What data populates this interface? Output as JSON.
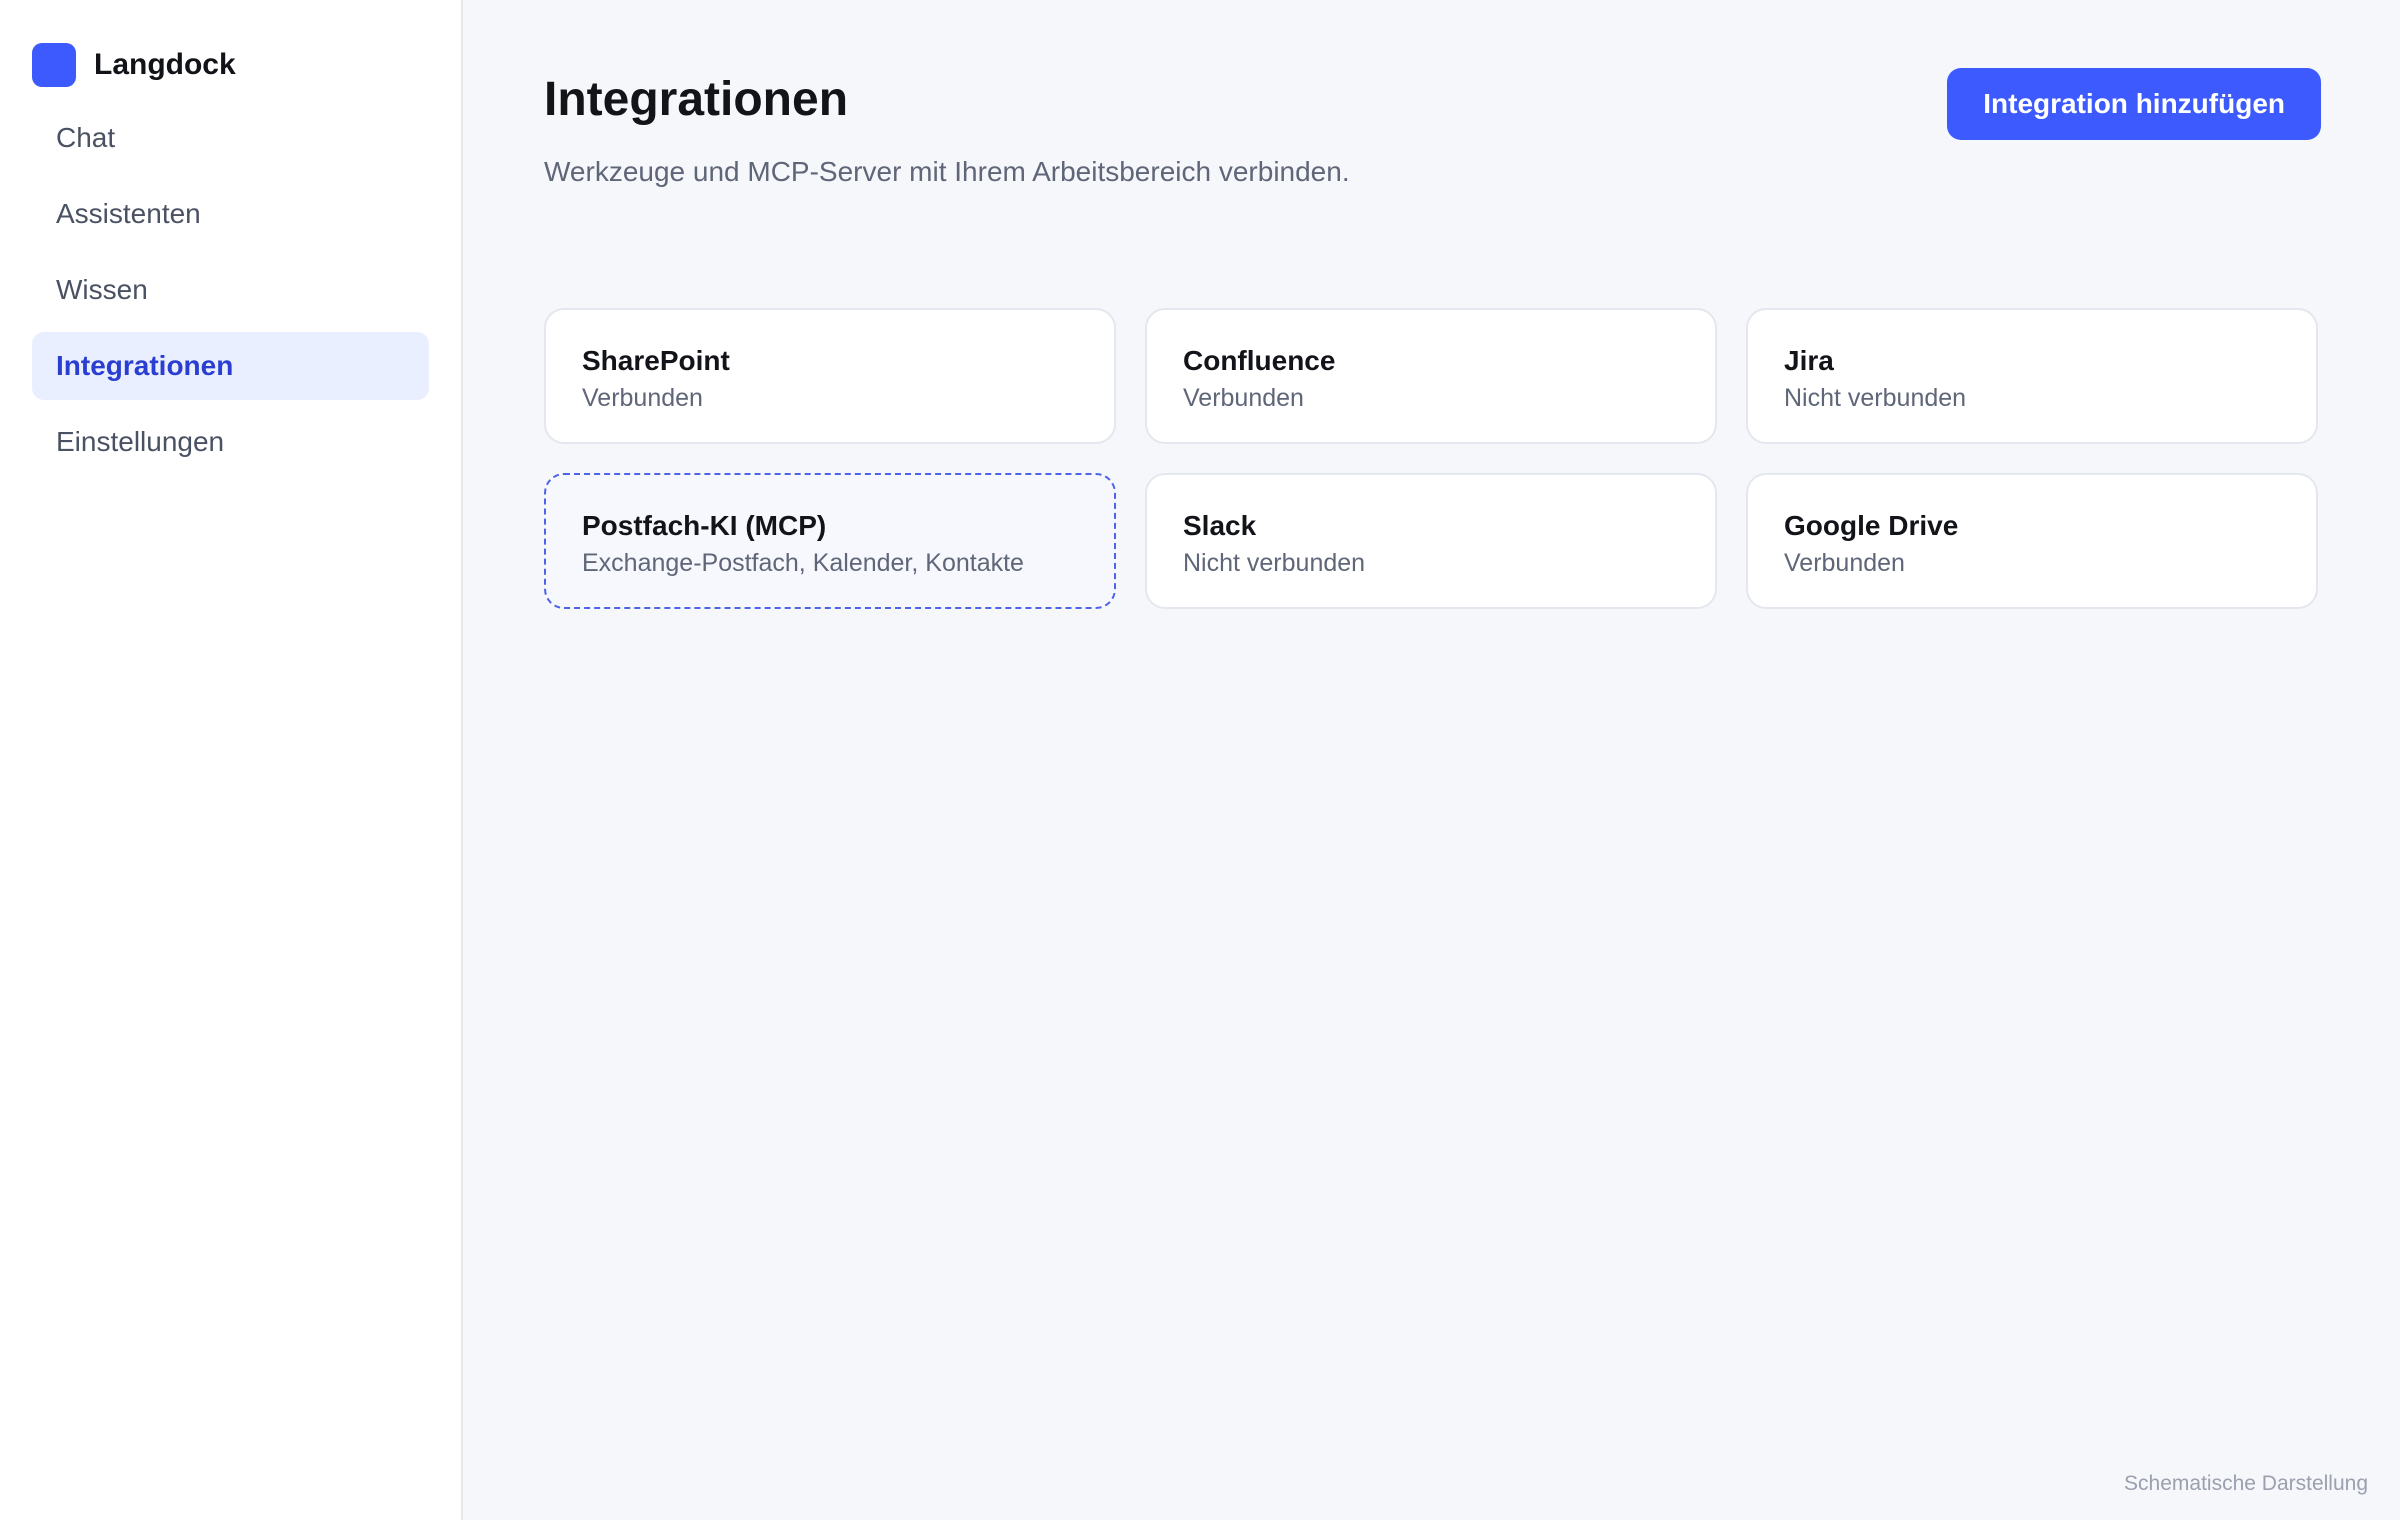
{
  "brand": {
    "name": "Langdock",
    "logo_color": "#3d5afe"
  },
  "sidebar": {
    "items": [
      {
        "label": "Chat",
        "active": false
      },
      {
        "label": "Assistenten",
        "active": false
      },
      {
        "label": "Wissen",
        "active": false
      },
      {
        "label": "Integrationen",
        "active": true
      },
      {
        "label": "Einstellungen",
        "active": false
      }
    ]
  },
  "header": {
    "title": "Integrationen",
    "subtitle": "Werkzeuge und MCP-Server mit Ihrem Arbeitsbereich verbinden.",
    "add_button_label": "Integration hinzufügen"
  },
  "integrations": [
    {
      "name": "SharePoint",
      "status": "Verbunden"
    },
    {
      "name": "Confluence",
      "status": "Verbunden"
    },
    {
      "name": "Jira",
      "status": "Nicht verbunden"
    },
    {
      "name": "Postfach-KI (MCP)",
      "status": "Exchange-Postfach, Kalender, Kontakte",
      "highlighted": true
    },
    {
      "name": "Slack",
      "status": "Nicht verbunden"
    },
    {
      "name": "Google Drive",
      "status": "Verbunden"
    }
  ],
  "footnote": "Schematische Darstellung",
  "colors": {
    "accent": "#3d5afe",
    "active_nav_bg": "#eaefff",
    "active_nav_text": "#2a3fd1",
    "page_bg": "#f6f7fb"
  }
}
